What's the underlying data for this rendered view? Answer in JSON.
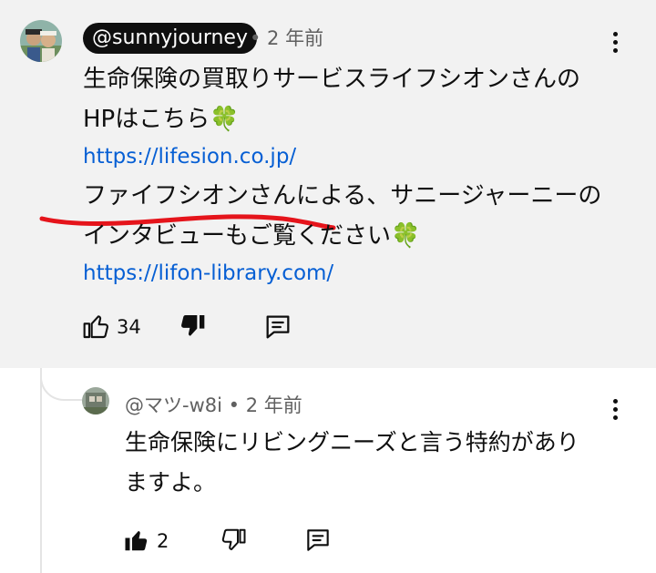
{
  "comment": {
    "handle": "@sunnyjourney",
    "time": "• 2 年前",
    "lines": [
      "生命保険の買取りサービスライフシオンさんの",
      "HPはこちら",
      "https://lifesion.co.jp/",
      "ファイフシオンさんによる、サニージャーニーの",
      "インタビューもご覧ください",
      "https://lifon-library.com/"
    ],
    "emoji": "🍀",
    "like_count": "34",
    "annotation_color": "#e5141b"
  },
  "reply": {
    "handle": "@マツ-w8i",
    "time": "• 2 年前",
    "lines": [
      "生命保険にリビングニーズと言う特約があり",
      "ますよ。"
    ],
    "like_count": "2"
  },
  "icons": {
    "like": "thumbs-up-icon",
    "dislike": "thumbs-down-icon",
    "reply": "comment-reply-icon",
    "more": "more-vert-icon"
  }
}
